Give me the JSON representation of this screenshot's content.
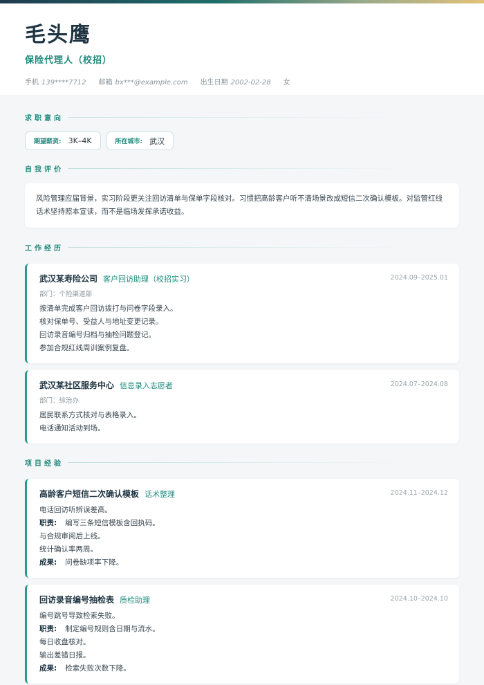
{
  "header": {
    "name": "毛头鹰",
    "role": "保险代理人（校招）",
    "contacts": [
      {
        "label": "手机",
        "value": "139****7712"
      },
      {
        "label": "邮箱",
        "value": "bx***@example.com"
      },
      {
        "label": "出生日期",
        "value": "2002-02-28"
      },
      {
        "label": "",
        "value": "女"
      }
    ]
  },
  "sections": {
    "intent": "求职意向",
    "summary": "自我评价",
    "work": "工作经历",
    "projects": "项目经验"
  },
  "intent": {
    "salary_label": "期望薪资:",
    "salary": "3K–4K",
    "city_label": "所在城市:",
    "city": "武汉"
  },
  "summary": "风险管理应届背景，实习阶段更关注回访清单与保单字段核对。习惯把高龄客户听不清场景改成短信二次确认模板。对监管红线话术坚持照本宣读，而不是临场发挥承诺收益。",
  "work": [
    {
      "org": "武汉某寿险公司",
      "position": "客户回访助理（校招实习）",
      "date": "2024.09–2025.01",
      "dept": "部门：个险渠道部",
      "lines": [
        "按清单完成客户回访拨打与问卷字段录入。",
        "核对保单号、受益人与地址变更记录。",
        "回访录音编号归档与抽检问题登记。",
        "参加合规红线周训案例复盘。"
      ]
    },
    {
      "org": "武汉某社区服务中心",
      "position": "信息录入志愿者",
      "date": "2024.07–2024.08",
      "dept": "部门：综治办",
      "lines": [
        "居民联系方式核对与表格录入。",
        "电话通知活动到场。"
      ]
    }
  ],
  "projects": [
    {
      "name": "高龄客户短信二次确认模板",
      "tag": "话术整理",
      "date": "2024.11–2024.12",
      "desc": "电话回访听辨误差高。",
      "duty_label": "职责:",
      "duties": [
        "编写三条短信模板含回执码。",
        "与合规审阅后上线。",
        "统计确认率两周。"
      ],
      "result_label": "成果:",
      "result": "问卷缺项率下降。"
    },
    {
      "name": "回访录音编号抽检表",
      "tag": "质检助理",
      "date": "2024.10–2024.10",
      "desc": "编号跳号导致检索失败。",
      "duty_label": "职责:",
      "duties": [
        "制定编号规则含日期与流水。",
        "每日收盘核对。",
        "输出差错日报。"
      ],
      "result_label": "成果:",
      "result": "检索失败次数下降。"
    }
  ],
  "colors": {
    "accent": "#1f8a7c",
    "dark": "#1e3442",
    "background": "#f4f6f8"
  }
}
